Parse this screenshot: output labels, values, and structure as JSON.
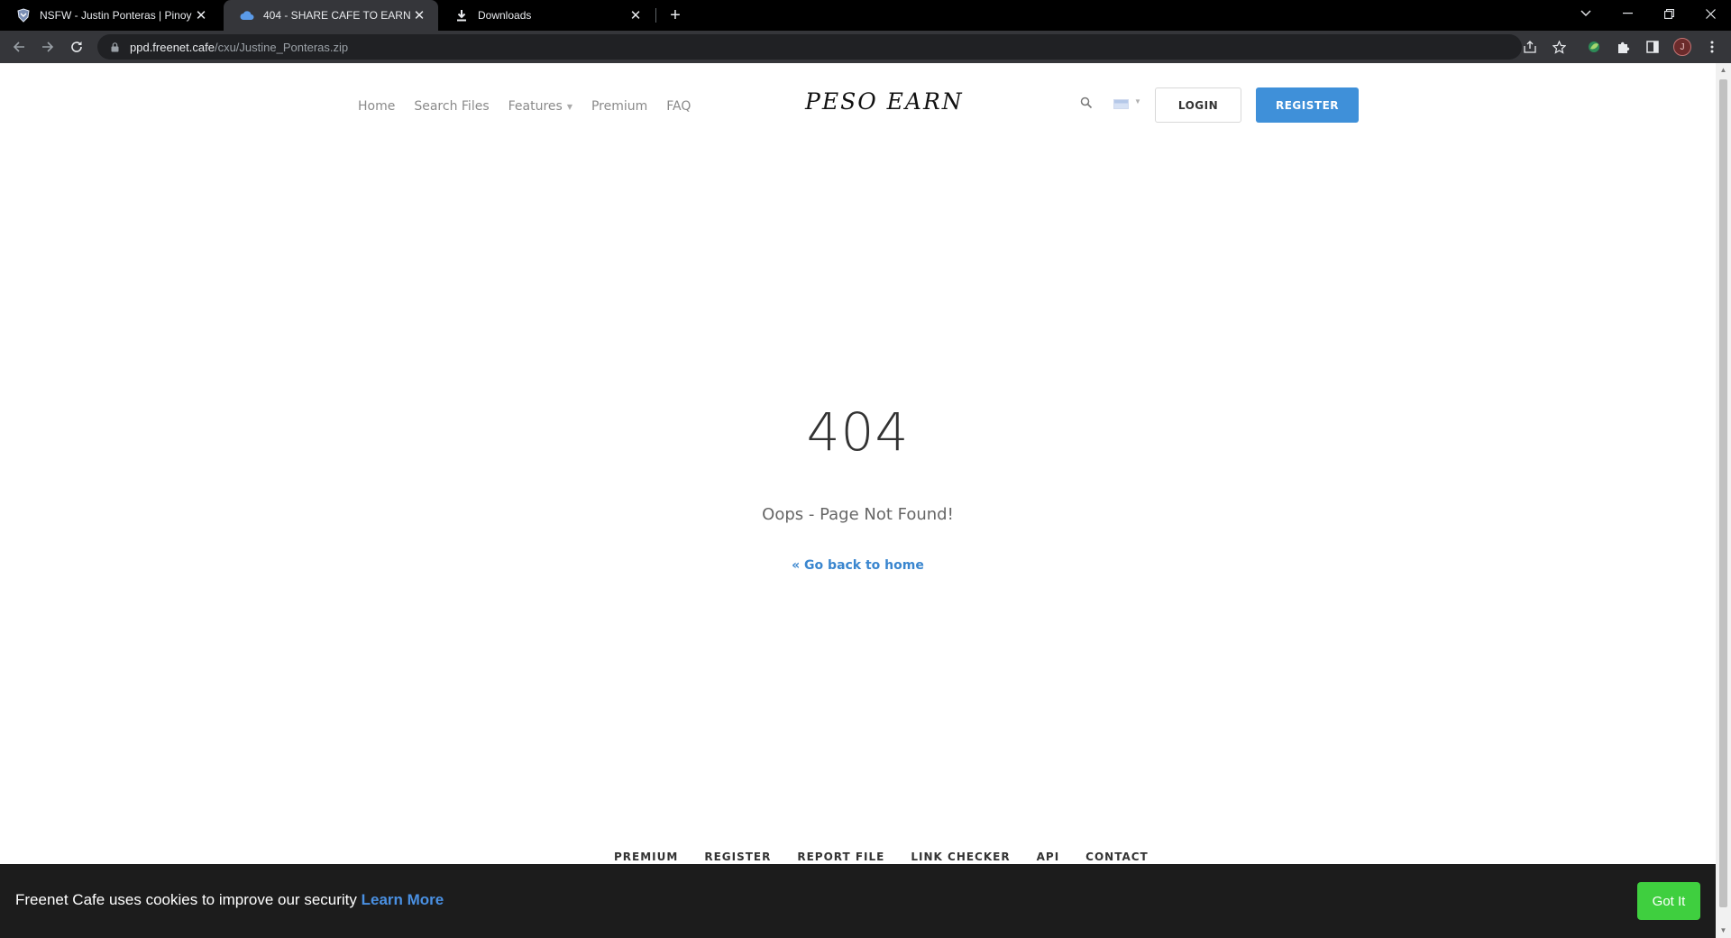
{
  "browser": {
    "tabs": [
      {
        "title": "NSFW - Justin Ponteras | Pinoy In",
        "icon": "shield-icon",
        "active": false
      },
      {
        "title": "404 - SHARE CAFE TO EARN",
        "icon": "cloud-icon",
        "active": true
      },
      {
        "title": "Downloads",
        "icon": "download-icon",
        "active": false
      }
    ],
    "new_tab": "+",
    "url_host": "ppd.freenet.cafe",
    "url_path": "/cxu/Justine_Ponteras.zip",
    "profile_initial": "J"
  },
  "site": {
    "nav": [
      {
        "label": "Home"
      },
      {
        "label": "Search Files"
      },
      {
        "label": "Features",
        "has_dropdown": true
      },
      {
        "label": "Premium"
      },
      {
        "label": "FAQ"
      }
    ],
    "logo_text": "PESO EARN",
    "login_label": "LOGIN",
    "register_label": "REGISTER"
  },
  "error": {
    "code": "404",
    "message": "Oops - Page Not Found!",
    "back_link": "« Go back to home"
  },
  "footer": {
    "links": [
      "PREMIUM",
      "REGISTER",
      "REPORT FILE",
      "LINK CHECKER",
      "API",
      "CONTACT"
    ]
  },
  "cookie_banner": {
    "text": "Freenet Cafe uses cookies to improve our security ",
    "learn_more": "Learn More",
    "button": "Got It"
  },
  "colors": {
    "accent_blue": "#3f90d9",
    "link_blue": "#3a86cf",
    "cookie_button": "#3fcf3f",
    "cookie_bg": "#1c1c1c"
  }
}
